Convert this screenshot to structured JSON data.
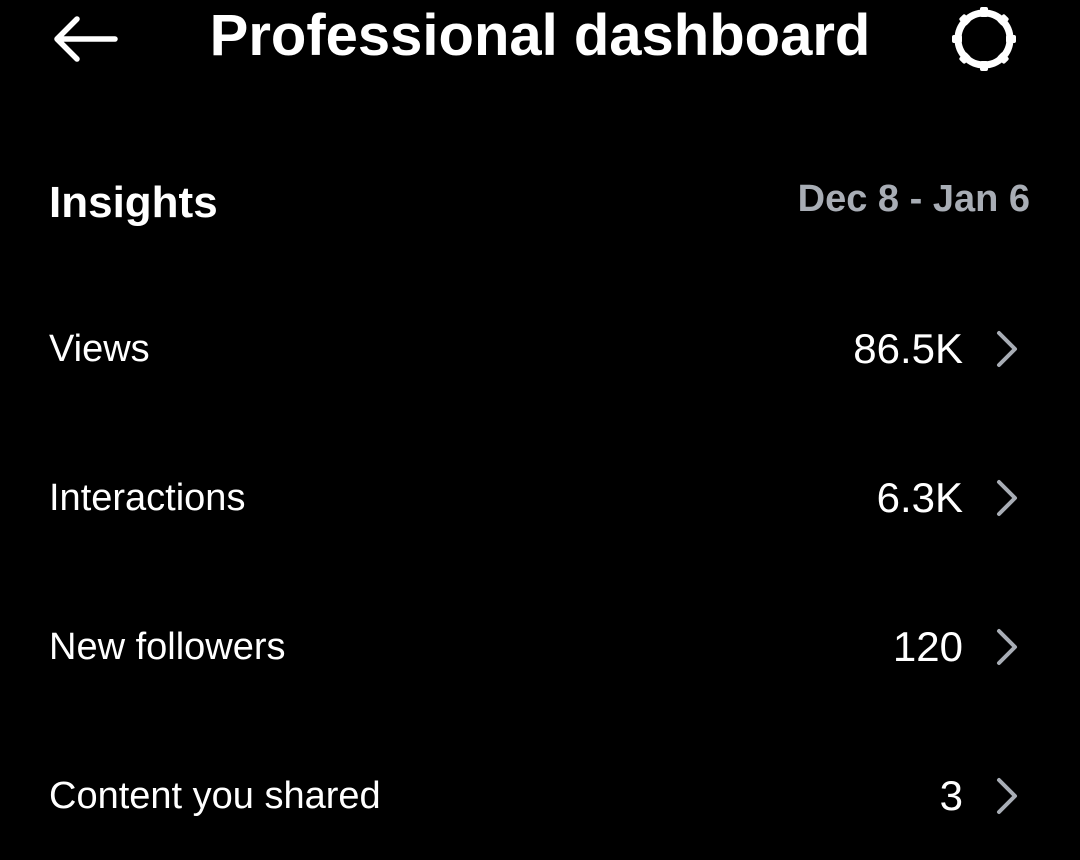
{
  "header": {
    "title": "Professional dashboard",
    "back_icon": "arrow-left-icon",
    "settings_icon": "gear-icon"
  },
  "insights": {
    "title": "Insights",
    "date_range": "Dec 8 - Jan 6",
    "metrics": [
      {
        "label": "Views",
        "value": "86.5K",
        "icon": "chevron-right-icon"
      },
      {
        "label": "Interactions",
        "value": "6.3K",
        "icon": "chevron-right-icon"
      },
      {
        "label": "New followers",
        "value": "120",
        "icon": "chevron-right-icon"
      },
      {
        "label": "Content you shared",
        "value": "3",
        "icon": "chevron-right-icon"
      }
    ]
  },
  "colors": {
    "background": "#000000",
    "text": "#ffffff",
    "muted": "#a8adb5",
    "chevron": "#a8adb5"
  }
}
